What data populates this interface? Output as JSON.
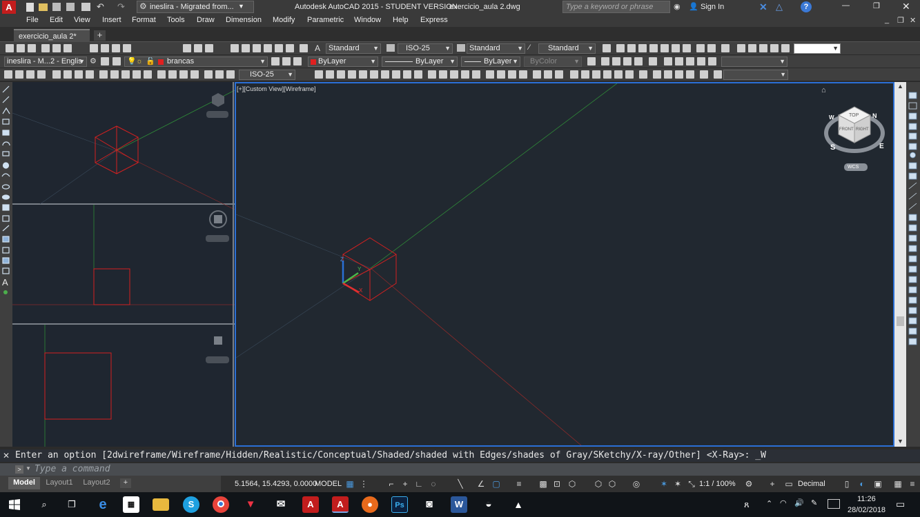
{
  "window": {
    "app_title": "Autodesk AutoCAD 2015 - STUDENT VERSION",
    "file_name": "exercicio_aula 2.dwg",
    "workspace_label": "ineslira - Migrated from...",
    "search_placeholder": "Type a keyword or phrase",
    "sign_in": "Sign In"
  },
  "menu": [
    "File",
    "Edit",
    "View",
    "Insert",
    "Format",
    "Tools",
    "Draw",
    "Dimension",
    "Modify",
    "Parametric",
    "Window",
    "Help",
    "Express"
  ],
  "doc_tab": "exercicio_aula 2*",
  "toolbar": {
    "text_style": "Standard",
    "dim_style": "ISO-25",
    "table_style": "Standard",
    "mleader_style": "Standard",
    "workspace": "ineslira - M...2 - Englis",
    "layer": "brancas",
    "color": "ByLayer",
    "linetype": "ByLayer",
    "lineweight": "ByLayer",
    "plotstyle": "ByColor",
    "dim_style2": "ISO-25"
  },
  "viewport": {
    "label": "[+][Custom View][Wireframe]",
    "viewcube": {
      "top": "TOP",
      "front": "FRONT",
      "right": "RIGHT",
      "n": "N",
      "s": "S",
      "e": "E",
      "w": "W",
      "wcs": "WCS"
    }
  },
  "command": {
    "history": "Enter an option [2dwireframe/Wireframe/Hidden/Realistic/Conceptual/Shaded/shaded with Edges/shades of Gray/SKetchy/X-ray/Other] <X-Ray>: _W",
    "placeholder": "Type a command"
  },
  "layout_tabs": [
    "Model",
    "Layout1",
    "Layout2"
  ],
  "status": {
    "coords": "5.1564, 15.4293, 0.0000",
    "model": "MODEL",
    "scale": "1:1 / 100%",
    "units": "Decimal"
  },
  "taskbar": {
    "time": "11:26",
    "date": "28/02/2018"
  },
  "colors": {
    "viewport_bg": "#212830",
    "accent": "#2a6fd6",
    "cube": "#d42020",
    "axis_x": "#b82c2c",
    "axis_y": "#2f9a3a"
  }
}
